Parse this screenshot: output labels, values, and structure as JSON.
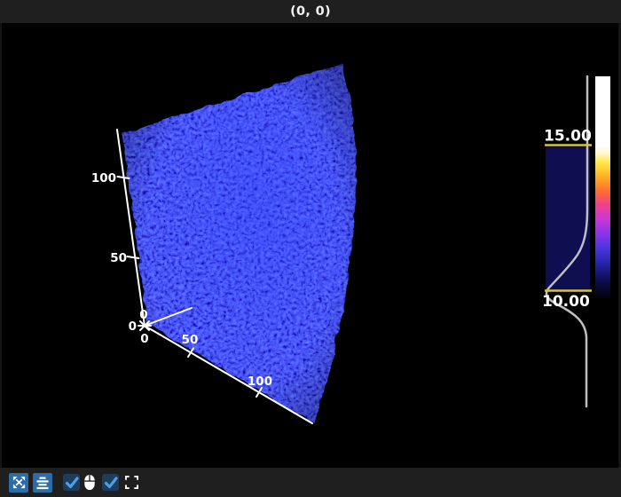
{
  "title_bar": {
    "label": "(0, 0)"
  },
  "scene": {
    "y_axis_ticks": [
      "100",
      "50",
      "0"
    ],
    "x_axis_ticks": [
      "0",
      "50",
      "100"
    ],
    "z_axis_ticks": [
      "0"
    ]
  },
  "lut_widget": {
    "vmax_label": "15.00",
    "vmin_label": "10.00",
    "colormap_stops": [
      {
        "offset": "0%",
        "color": "#ffffff"
      },
      {
        "offset": "31%",
        "color": "#ffffff"
      },
      {
        "offset": "34.5%",
        "color": "#fff8d0"
      },
      {
        "offset": "39%",
        "color": "#ffe743"
      },
      {
        "offset": "46%",
        "color": "#ffa722"
      },
      {
        "offset": "52%",
        "color": "#ff6a33"
      },
      {
        "offset": "58%",
        "color": "#f0418f"
      },
      {
        "offset": "64.5%",
        "color": "#c936d8"
      },
      {
        "offset": "71%",
        "color": "#8a35e8"
      },
      {
        "offset": "77.5%",
        "color": "#4b35dc"
      },
      {
        "offset": "84%",
        "color": "#2526ae"
      },
      {
        "offset": "91.5%",
        "color": "#0e0e55"
      },
      {
        "offset": "100%",
        "color": "#020208"
      }
    ]
  },
  "toolbar": {
    "buttons": [
      {
        "name": "panzoom",
        "icon": "expand-arrows-icon"
      },
      {
        "name": "center-scene",
        "icon": "align-center-icon"
      },
      {
        "name": "toggle-1",
        "icon": "checkbox-icon",
        "checked": true
      },
      {
        "name": "controller",
        "icon": "mouse-icon"
      },
      {
        "name": "toggle-2",
        "icon": "checkbox-icon",
        "checked": true
      },
      {
        "name": "fullscreen",
        "icon": "fullscreen-icon"
      }
    ]
  },
  "theme": {
    "chrome-bg": "#1f1f1f",
    "canvas-bg": "#000000",
    "axis-color": "#ffffff",
    "btn-bg": "#2d6ca5",
    "check-bg": "#1e3c5c",
    "check-color": "#4aa0e8",
    "clamp-color": "#d4c24c",
    "histbox-color": "#0e0e50",
    "curve-color": "#c9c9c9"
  },
  "chart_data": {
    "type": "3d-volume-render",
    "title": "(0, 0)",
    "x_ticks": [
      0,
      50,
      100
    ],
    "y_ticks": [
      0,
      50,
      100
    ],
    "z_ticks": [
      0
    ],
    "contrast_limits": {
      "vmin": 10.0,
      "vmax": 15.0
    },
    "colormap_high_to_low": [
      "#ffffff",
      "#ffe743",
      "#ffa722",
      "#f0418f",
      "#8a35e8",
      "#2526ae",
      "#020208"
    ],
    "volume_dominant_color": "#1a1ae0",
    "legend_position": "right-colorbar"
  }
}
